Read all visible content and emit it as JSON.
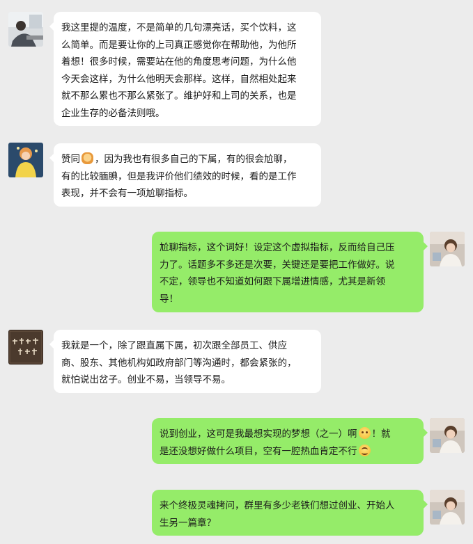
{
  "colors": {
    "background": "#ececec",
    "incoming_bubble": "#ffffff",
    "outgoing_bubble": "#95ec69",
    "text": "#1a1a1a"
  },
  "messages": [
    {
      "side": "left",
      "avatar": "man-at-desk-photo",
      "lines": [
        "我这里提的温度，不是简单的几句漂亮话，买个饮料，这",
        "么简单。而是要让你的上司真正感觉你在帮助他，为他所",
        "着想！很多时候，需要站在他的角度思考问题，为什么他",
        "今天会这样，为什么他明天会那样。这样，自然相处起来",
        "就不那么累也不那么紧张了。维护好和上司的关系，也是",
        "企业生存的必备法则哦。"
      ]
    },
    {
      "side": "left",
      "avatar": "yellow-dress-character",
      "line1_before": "赞同",
      "line1_emoji": "clap-emoji",
      "line1_after": "，因为我也有很多自己的下属，有的很会尬聊，",
      "lines": [
        "有的比较腼腆，但是我评价他们绩效的时候，看的是工作",
        "表现，并不会有一项尬聊指标。"
      ]
    },
    {
      "side": "right",
      "avatar": "child-photo",
      "lines": [
        "尬聊指标，这个词好！设定这个虚拟指标，反而给自己压",
        "力了。话题多不多还是次要，关键还是要把工作做好。说",
        "不定，领导也不知道如何跟下属增进情感，尤其是新领",
        "导！"
      ]
    },
    {
      "side": "left",
      "avatar": "calligraphy-text-avatar",
      "lines": [
        "我就是一个，除了跟直属下属，初次跟全部员工、供应",
        "商、股东、其他机构如政府部门等沟通时，都会紧张的，",
        "就怕说出岔子。创业不易，当领导不易。"
      ]
    },
    {
      "side": "right",
      "avatar": "child-photo",
      "line1_before": "说到创业，这可是我最想实现的梦想（之一）啊",
      "line1_emoji": "cry-emoji",
      "line1_after": "！就",
      "line2_before": "是还没想好做什么项目，空有一腔热血肯定不行",
      "line2_emoji": "smile-emoji"
    },
    {
      "side": "right",
      "avatar": "child-photo",
      "lines": [
        "来个终极灵魂拷问，群里有多少老铁们想过创业、开始人",
        "生另一篇章？"
      ]
    }
  ]
}
